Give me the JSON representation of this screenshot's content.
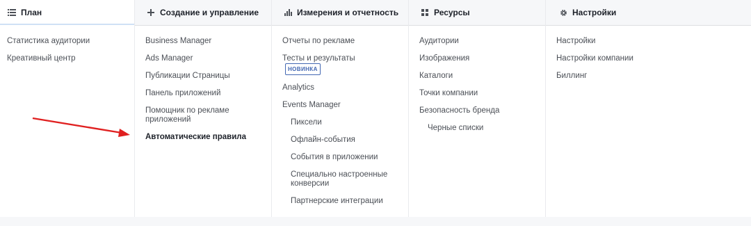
{
  "columns": [
    {
      "id": "plan",
      "title": "План",
      "icon": "list-icon",
      "items": [
        {
          "label": "Статистика аудитории"
        },
        {
          "label": "Креативный центр"
        }
      ]
    },
    {
      "id": "create",
      "title": "Создание и управление",
      "icon": "plus-icon",
      "items": [
        {
          "label": "Business Manager"
        },
        {
          "label": "Ads Manager"
        },
        {
          "label": "Публикации Страницы"
        },
        {
          "label": "Панель приложений"
        },
        {
          "label": "Помощник по рекламе приложений"
        },
        {
          "label": "Автоматические правила",
          "emphasis": true
        }
      ]
    },
    {
      "id": "measure",
      "title": "Измерения и отчетность",
      "icon": "bar-chart-icon",
      "items": [
        {
          "label": "Отчеты по рекламе"
        },
        {
          "label": "Тесты и результаты",
          "badge": "НОВИНКА"
        },
        {
          "label": "Analytics"
        },
        {
          "label": "Events Manager"
        },
        {
          "label": "Пиксели",
          "sub": true
        },
        {
          "label": "Офлайн-события",
          "sub": true
        },
        {
          "label": "События в приложении",
          "sub": true
        },
        {
          "label": "Специально настроенные конверсии",
          "sub": true
        },
        {
          "label": "Партнерские интеграции",
          "sub": true
        }
      ]
    },
    {
      "id": "resources",
      "title": "Ресурсы",
      "icon": "grid-icon",
      "items": [
        {
          "label": "Аудитории"
        },
        {
          "label": "Изображения"
        },
        {
          "label": "Каталоги"
        },
        {
          "label": "Точки компании"
        },
        {
          "label": "Безопасность бренда"
        },
        {
          "label": "Черные списки",
          "sub": true
        }
      ]
    },
    {
      "id": "settings",
      "title": "Настройки",
      "icon": "gear-icon",
      "items": [
        {
          "label": "Настройки"
        },
        {
          "label": "Настройки компании"
        },
        {
          "label": "Биллинг"
        }
      ]
    }
  ],
  "colors": {
    "accent": "#4267b2",
    "arrow": "#e02020"
  }
}
